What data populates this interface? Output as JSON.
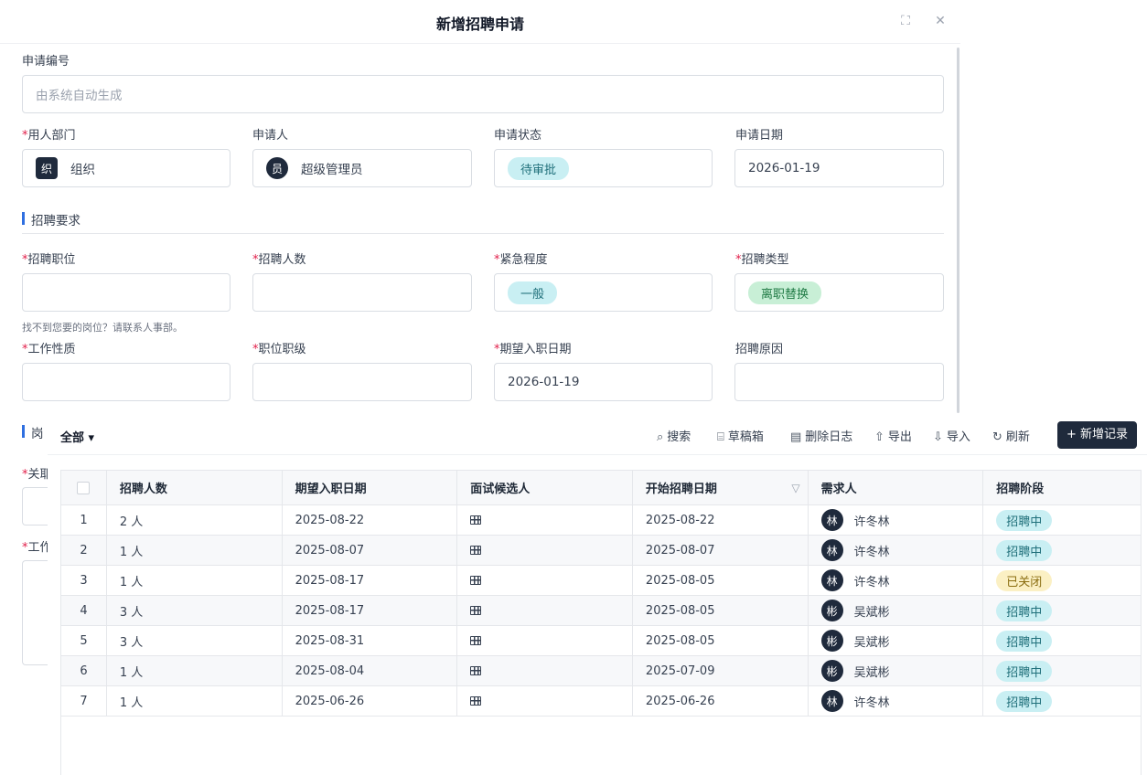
{
  "modal": {
    "title": "新增招聘申请",
    "fullscreen_icon": "expand-icon",
    "close_icon": "close-icon"
  },
  "form": {
    "app_no": {
      "label": "申请编号",
      "placeholder": "由系统自动生成"
    },
    "department": {
      "label": "用人部门",
      "avatar": "织",
      "value": "组织"
    },
    "applicant": {
      "label": "申请人",
      "avatar": "员",
      "value": "超级管理员"
    },
    "status": {
      "label": "申请状态",
      "value": "待审批"
    },
    "date": {
      "label": "申请日期",
      "value": "2026-01-19"
    },
    "section_requirements": "招聘要求",
    "position": {
      "label": "招聘职位",
      "value": ""
    },
    "headcount": {
      "label": "招聘人数",
      "value": ""
    },
    "urgency": {
      "label": "紧急程度",
      "value": "一般"
    },
    "rec_type": {
      "label": "招聘类型",
      "value": "离职替换"
    },
    "position_hint": "找不到您要的岗位？请联系人事部。",
    "work_nature": {
      "label": "工作性质",
      "value": ""
    },
    "job_level": {
      "label": "职位职级",
      "value": ""
    },
    "expected_date": {
      "label": "期望入职日期",
      "value": "2026-01-19"
    },
    "reason": {
      "label": "招聘原因",
      "value": ""
    },
    "section_post": "岗",
    "related_label": "关耶",
    "work_label": "工作"
  },
  "panel": {
    "filter": "全部 ▾",
    "tools": {
      "search": "搜索",
      "drafts": "草稿箱",
      "delete_log": "删除日志",
      "export": "导出",
      "import": "导入",
      "refresh": "刷新"
    },
    "add_button": "+ 新增记录"
  },
  "table": {
    "columns": [
      "招聘人数",
      "期望入职日期",
      "面试候选人",
      "开始招聘日期",
      "需求人",
      "招聘阶段"
    ],
    "rows": [
      {
        "idx": "1",
        "count": "2 人",
        "expected": "2025-08-22",
        "start": "2025-08-22",
        "avatar": "林",
        "requester": "许冬林",
        "stage": "招聘中",
        "stage_kind": "cyan"
      },
      {
        "idx": "2",
        "count": "1 人",
        "expected": "2025-08-07",
        "start": "2025-08-07",
        "avatar": "林",
        "requester": "许冬林",
        "stage": "招聘中",
        "stage_kind": "cyan"
      },
      {
        "idx": "3",
        "count": "1 人",
        "expected": "2025-08-17",
        "start": "2025-08-05",
        "avatar": "林",
        "requester": "许冬林",
        "stage": "已关闭",
        "stage_kind": "yellow"
      },
      {
        "idx": "4",
        "count": "3 人",
        "expected": "2025-08-17",
        "start": "2025-08-05",
        "avatar": "彬",
        "requester": "吴斌彬",
        "stage": "招聘中",
        "stage_kind": "cyan"
      },
      {
        "idx": "5",
        "count": "3 人",
        "expected": "2025-08-31",
        "start": "2025-08-05",
        "avatar": "彬",
        "requester": "吴斌彬",
        "stage": "招聘中",
        "stage_kind": "cyan"
      },
      {
        "idx": "6",
        "count": "1 人",
        "expected": "2025-08-04",
        "start": "2025-07-09",
        "avatar": "彬",
        "requester": "吴斌彬",
        "stage": "招聘中",
        "stage_kind": "cyan"
      },
      {
        "idx": "7",
        "count": "1 人",
        "expected": "2025-06-26",
        "start": "2025-06-26",
        "avatar": "林",
        "requester": "许冬林",
        "stage": "招聘中",
        "stage_kind": "cyan"
      }
    ]
  }
}
